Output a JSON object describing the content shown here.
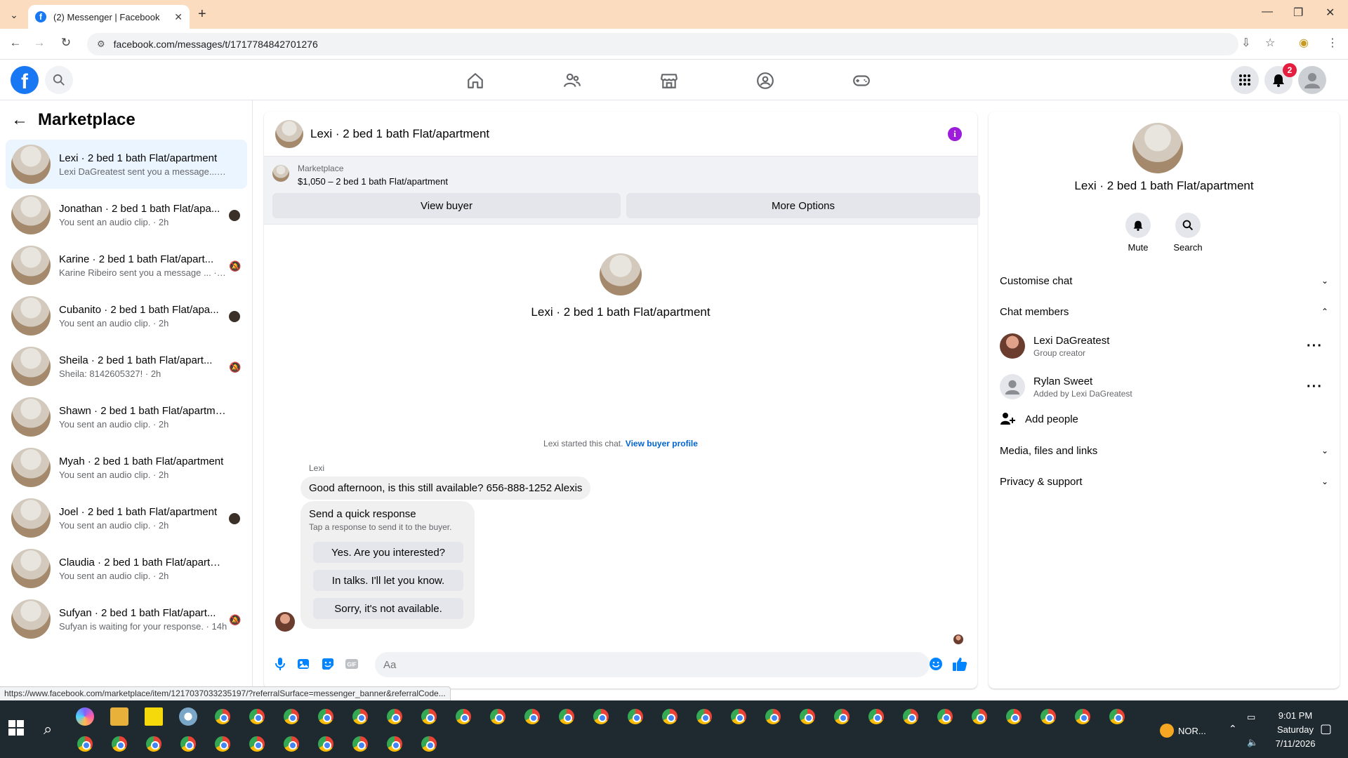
{
  "browser": {
    "tab_title": "(2) Messenger | Facebook",
    "url": "facebook.com/messages/t/1717784842701276",
    "status_url": "https://www.facebook.com/marketplace/item/1217037033235197/?referralSurface=messenger_banner&referralCode..."
  },
  "fb": {
    "notification_count": "2"
  },
  "sidebar": {
    "title": "Marketplace",
    "conversations": [
      {
        "name": "Lexi · 2 bed 1 bath Flat/apartment",
        "sub": "Lexi DaGreatest sent you a message... · 19m",
        "status": "none"
      },
      {
        "name": "Jonathan · 2 bed 1 bath Flat/apa...",
        "sub": "You sent an audio clip. · 2h",
        "status": "seen"
      },
      {
        "name": "Karine · 2 bed 1 bath Flat/apart...",
        "sub": "Karine Ribeiro sent you a message ... · 2h",
        "status": "muted"
      },
      {
        "name": "Cubanito · 2 bed 1 bath Flat/apa...",
        "sub": "You sent an audio clip. · 2h",
        "status": "seen"
      },
      {
        "name": "Sheila · 2 bed 1 bath Flat/apart...",
        "sub": "Sheila: 8142605327! · 2h",
        "status": "muted"
      },
      {
        "name": "Shawn · 2 bed 1 bath Flat/apartment",
        "sub": "You sent an audio clip. · 2h",
        "status": "none"
      },
      {
        "name": "Myah · 2 bed 1 bath Flat/apartment",
        "sub": "You sent an audio clip. · 2h",
        "status": "none"
      },
      {
        "name": "Joel · 2 bed 1 bath Flat/apartment",
        "sub": "You sent an audio clip. · 2h",
        "status": "seen"
      },
      {
        "name": "Claudia · 2 bed 1 bath Flat/apartm...",
        "sub": "You sent an audio clip. · 2h",
        "status": "none"
      },
      {
        "name": "Sufyan · 2 bed 1 bath Flat/apart...",
        "sub": "Sufyan is waiting for your response. · 14h",
        "status": "muted"
      }
    ]
  },
  "chat": {
    "title": "Lexi · 2 bed 1 bath Flat/apartment",
    "listing_label": "Marketplace",
    "listing_price": "$1,050 – 2 bed 1 bath Flat/apartment",
    "view_buyer": "View buyer",
    "more_options": "More Options",
    "intro_title": "Lexi · 2 bed 1 bath Flat/apartment",
    "started_text": "Lexi started this chat.",
    "view_buyer_profile": "View buyer profile",
    "sender": "Lexi",
    "message": "Good afternoon, is this still available? 656-888-1252 Alexis",
    "quick_title": "Send a quick response",
    "quick_sub": "Tap a response to send it to the buyer.",
    "quick_replies": [
      "Yes. Are you interested?",
      "In talks. I'll let you know.",
      "Sorry, it's not available."
    ],
    "composer_placeholder": "Aa"
  },
  "details": {
    "title": "Lexi · 2 bed 1 bath Flat/apartment",
    "mute": "Mute",
    "search": "Search",
    "customise_chat": "Customise chat",
    "chat_members": "Chat members",
    "members": [
      {
        "name": "Lexi DaGreatest",
        "sub": "Group creator"
      },
      {
        "name": "Rylan Sweet",
        "sub": "Added by Lexi DaGreatest"
      }
    ],
    "add_people": "Add people",
    "media_files": "Media, files and links",
    "privacy_support": "Privacy & support"
  },
  "taskbar": {
    "weather": "NOR...",
    "time": "9:01 PM",
    "day": "Saturday",
    "date": "7/11/2026"
  },
  "colors": {
    "fb_blue": "#1877f2",
    "messenger_blue": "#0084ff",
    "info_purple": "#9d1bdb",
    "tab_strip": "#fbdcbf"
  }
}
